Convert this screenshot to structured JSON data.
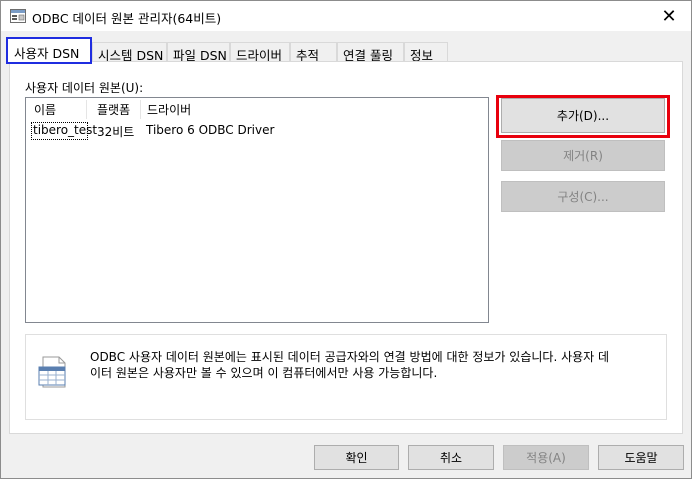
{
  "window": {
    "title": "ODBC 데이터 원본 관리자(64비트)",
    "close_glyph": "✕",
    "icon": "odbc-admin-icon"
  },
  "tabs": [
    {
      "label": "사용자 DSN",
      "active": true
    },
    {
      "label": "시스템 DSN",
      "active": false
    },
    {
      "label": "파일 DSN",
      "active": false
    },
    {
      "label": "드라이버",
      "active": false
    },
    {
      "label": "추적",
      "active": false
    },
    {
      "label": "연결 풀링",
      "active": false
    },
    {
      "label": "정보",
      "active": false
    }
  ],
  "user_dsn": {
    "section_label": "사용자 데이터 원본(U):",
    "columns": [
      "이름",
      "플랫폼",
      "드라이버"
    ],
    "rows": [
      {
        "name": "tibero_test",
        "platform": "32비트",
        "driver": "Tibero 6 ODBC Driver"
      }
    ]
  },
  "buttons": {
    "add": {
      "label": "추가(D)...",
      "enabled": true
    },
    "remove": {
      "label": "제거(R)",
      "enabled": false
    },
    "configure": {
      "label": "구성(C)...",
      "enabled": false
    }
  },
  "info": {
    "icon": "data-source-icon",
    "line1": "ODBC 사용자 데이터 원본에는 표시된 데이터 공급자와의 연결 방법에 대한 정보가 있습니다. 사용자 데",
    "line2": "이터 원본은 사용자만 볼 수 있으며 이 컴퓨터에서만 사용 가능합니다."
  },
  "footer": {
    "ok": {
      "label": "확인",
      "enabled": true
    },
    "cancel": {
      "label": "취소",
      "enabled": true
    },
    "apply": {
      "label": "적용(A)",
      "enabled": false
    },
    "help": {
      "label": "도움말",
      "enabled": true
    }
  },
  "colors": {
    "active_tab_highlight": "#1f2de0",
    "add_button_highlight": "#e8000d"
  }
}
